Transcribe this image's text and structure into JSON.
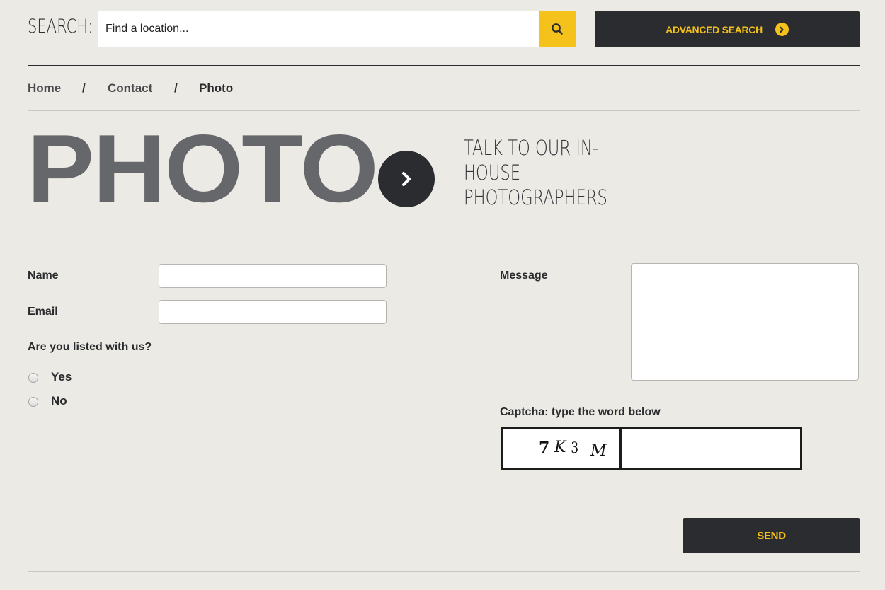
{
  "search": {
    "label": "SEARCH:",
    "placeholder": "Find a location...",
    "advanced_label": "ADVANCED SEARCH"
  },
  "breadcrumb": {
    "items": [
      "Home",
      "Contact",
      "Photo"
    ],
    "separator": "/"
  },
  "heading": {
    "title": "PHOTO",
    "subtitle": "TALK TO OUR IN-HOUSE PHOTOGRAPHERS"
  },
  "form": {
    "name_label": "Name",
    "email_label": "Email",
    "listed_question": "Are you listed with us?",
    "options": [
      "Yes",
      "No"
    ],
    "message_label": "Message",
    "captcha_label": "Captcha: type the word below",
    "captcha_chars": [
      "7",
      "K",
      "3",
      "M"
    ],
    "send_label": "SEND"
  },
  "colors": {
    "accent": "#f4c21a",
    "dark": "#2a2c30",
    "background": "#eceae4",
    "title_gray": "#66676b"
  },
  "icons": {
    "search": "search-icon",
    "advanced": "chevron-right-circle-icon",
    "heading_arrow": "chevron-right-icon"
  }
}
